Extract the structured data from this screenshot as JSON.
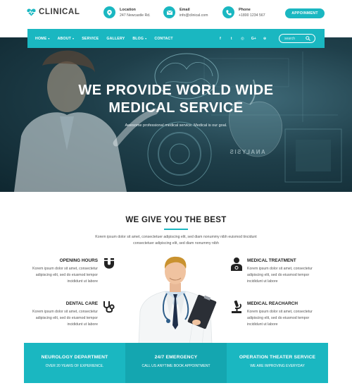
{
  "header": {
    "logo": "CLINICAL",
    "location": {
      "title": "Location",
      "value": "247 Newcastle Rd."
    },
    "email": {
      "title": "Email",
      "value": "info@clinical.com"
    },
    "phone": {
      "title": "Phone",
      "value": "+1800 1234 567"
    },
    "appointment_label": "APPOINMENT"
  },
  "nav": {
    "items": [
      {
        "label": "HOME",
        "dropdown": true
      },
      {
        "label": "ABOUT",
        "dropdown": true
      },
      {
        "label": "SERVICE",
        "dropdown": false
      },
      {
        "label": "GALLERY",
        "dropdown": false
      },
      {
        "label": "BLOG",
        "dropdown": true
      },
      {
        "label": "CONTACT",
        "dropdown": false
      }
    ],
    "social_icons": [
      "facebook-icon",
      "twitter-icon",
      "instagram-icon",
      "google-plus-icon",
      "dribbble-icon"
    ],
    "social_glyphs": [
      "f",
      "t",
      "◎",
      "G+",
      "⊕"
    ],
    "search_placeholder": "search"
  },
  "hero": {
    "title_line1": "WE PROVIDE WORLD WIDE",
    "title_line2": "MEDICAL SERVICE",
    "subtitle": "Awesome professional medical service. Medical is our goal.",
    "overlay_text": "ANALYSIS"
  },
  "best": {
    "title": "WE GIVE YOU THE BEST",
    "desc_line1": "Korem ipsum dolor sit amet, consectetuer adipiscing elit, sed diam nonummy nibh euismod tincidunt",
    "desc_line2": "consectetuer adipiscing elit, sed diam nonummy nibh"
  },
  "features": [
    {
      "title": "OPENING HOURS",
      "icon": "magnet-icon",
      "desc1": "Korem ipsum dolor sit amet, consectetur",
      "desc2": "adipiscing elit, sed do eiusmod tempor",
      "desc3": "incididunt ut labore"
    },
    {
      "title": "MEDICAL TREATMENT",
      "icon": "doctor-icon",
      "desc1": "Korem ipsum dolor sit amet, consectetur",
      "desc2": "adipiscing elit, sed do eiusmod tempor",
      "desc3": "incididunt ut labore"
    },
    {
      "title": "DENTAL CARE",
      "icon": "stethoscope-icon",
      "desc1": "Korem ipsum dolor sit amet, consectetur",
      "desc2": "adipiscing elit, sed do eiusmod tempor",
      "desc3": "incididunt ut labore"
    },
    {
      "title": "MEDICAL REACHARCH",
      "icon": "microscope-icon",
      "desc1": "Korem ipsum dolor sit amet, consectetur",
      "desc2": "adipiscing elit, sed do eiusmod tempor",
      "desc3": "incididunt ut labore"
    }
  ],
  "bottom": [
    {
      "title": "NEUROLOGY DEPARTMENT",
      "sub": "OVER 20 YEARS OF EXPERIENCE.",
      "color": "#1ab7c1"
    },
    {
      "title": "24/7 EMERGENCY",
      "sub": "CALL US ANYTIME BOOK APPOINTMENT",
      "color": "#14a6b0"
    },
    {
      "title": "OPERATION THEATER SERVICE",
      "sub": "WE ARE IMPROVING EVERYDAY",
      "color": "#1ab7c1"
    }
  ],
  "colors": {
    "accent": "#1ab7c1",
    "accent_dark": "#14a6b0",
    "hero_dark": "#1f3f4a"
  }
}
